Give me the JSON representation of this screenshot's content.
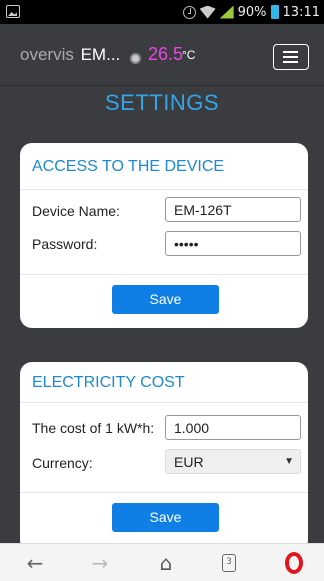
{
  "status_bar": {
    "battery": "90%",
    "time": "13:11"
  },
  "header": {
    "brand": "overvis",
    "model": "EM...",
    "temperature": "26.5",
    "temperature_unit": "°C",
    "menu_icon": "hamburger-menu-icon"
  },
  "page_title": "SETTINGS",
  "access_card": {
    "title": "ACCESS TO THE DEVICE",
    "device_name_label": "Device Name:",
    "device_name_value": "EM-126T",
    "password_label": "Password:",
    "password_value": "•••••",
    "save_label": "Save"
  },
  "cost_card": {
    "title": "ELECTRICITY COST",
    "cost_label": "The cost of 1 kW*h:",
    "cost_value": "1.000",
    "currency_label": "Currency:",
    "currency_value": "EUR",
    "save_label": "Save"
  },
  "bottom_nav": {
    "back_icon": "arrow-left-icon",
    "forward_icon": "arrow-right-icon",
    "home_icon": "home-icon",
    "tabs_count": "3",
    "opera_icon": "opera-icon"
  },
  "colors": {
    "accent": "#34a5e8",
    "temperature": "#e846e8",
    "button": "#0f7fe6",
    "header_bg": "#3a3c3f"
  }
}
